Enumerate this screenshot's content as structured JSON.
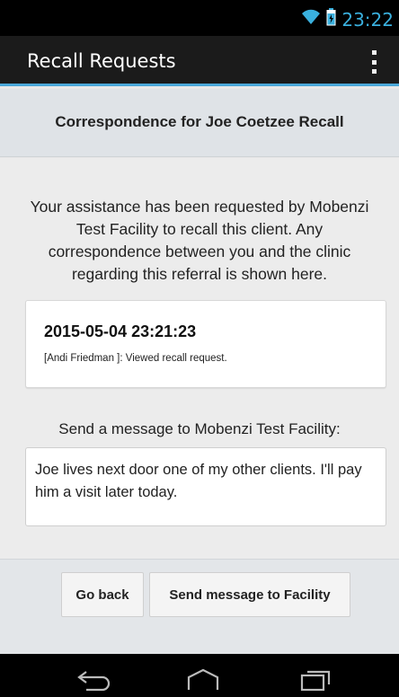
{
  "status_bar": {
    "time": "23:22",
    "icons": [
      "wifi-icon",
      "battery-icon"
    ],
    "accent": "#3ab0de"
  },
  "app_bar": {
    "title": "Recall Requests",
    "menu_icon": "overflow-menu-icon",
    "accent": "#4aa7d8"
  },
  "subheader": {
    "title": "Correspondence for Joe Coetzee Recall"
  },
  "main": {
    "intro": "Your assistance has been requested by Mobenzi Test Facility to recall this client. Any correspondence between you and the clinic regarding this referral is shown here.",
    "correspondence": [
      {
        "timestamp": "2015-05-04 23:21:23",
        "note": "[Andi Friedman ]: Viewed recall request."
      }
    ],
    "send_label": "Send a message to Mobenzi Test Facility:",
    "message_value": "Joe lives next door one of my other clients. I'll pay him a visit later today."
  },
  "actions": {
    "back_label": "Go back",
    "send_label": "Send message to Facility"
  },
  "nav_bar": {
    "icons": [
      "back-icon",
      "home-icon",
      "recent-apps-icon"
    ]
  }
}
